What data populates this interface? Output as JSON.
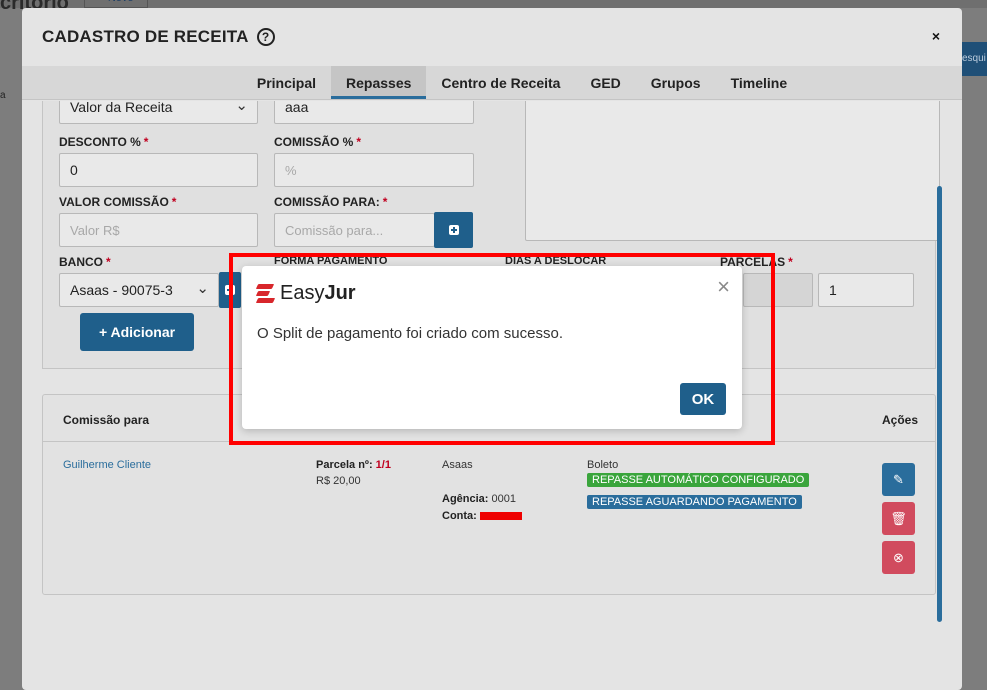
{
  "background": {
    "page_title": "critório",
    "new_button": "+ Novo",
    "left_text": "a",
    "search_btn": "esqui"
  },
  "modal": {
    "title": "CADASTRO DE RECEITA",
    "help_icon": "question-circle-icon",
    "close": "×",
    "tabs": [
      {
        "label": "Principal"
      },
      {
        "label": "Repasses"
      },
      {
        "label": "Centro de Receita"
      },
      {
        "label": "GED"
      },
      {
        "label": "Grupos"
      },
      {
        "label": "Timeline"
      }
    ],
    "active_tab": "Repasses"
  },
  "form": {
    "tipo_valor": "Valor da Receita",
    "descricao_value": "aaa",
    "desconto_label": "DESCONTO %",
    "desconto_value": "0",
    "comissao_pct_label": "COMISSÃO %",
    "comissao_pct_placeholder": "%",
    "valor_comissao_label": "VALOR COMISSÃO",
    "valor_comissao_placeholder": "Valor R$",
    "comissao_para_label": "COMISSÃO PARA:",
    "comissao_para_placeholder": "Comissão para...",
    "banco_label": "BANCO",
    "banco_value": "Asaas - 90075-3",
    "forma_pagamento_label": "FORMA PAGAMENTO",
    "dias_label": "DIAS A DESLOCAR",
    "parcelas_label": "PARCELAS",
    "parcelas_value": "1",
    "required_mark": "*",
    "adicionar_button": "+ Adicionar"
  },
  "table": {
    "headers": {
      "comissao_para": "Comissão para",
      "acoes": "Ações"
    },
    "row": {
      "nome": "Guilherme Cliente",
      "parcela_label": "Parcela nº:",
      "parcela_value": "1/1",
      "valor": "R$ 20,00",
      "banco": "Asaas",
      "agencia_label": "Agência:",
      "agencia_value": "0001",
      "conta_label": "Conta:",
      "forma": "Boleto",
      "tag_configurado": "REPASSE AUTOMÁTICO CONFIGURADO",
      "tag_aguardando": "REPASSE AGUARDANDO PAGAMENTO"
    }
  },
  "alert": {
    "brand_light": "Easy",
    "brand_bold": "Jur",
    "close": "×",
    "message": "O Split de pagamento foi criado com sucesso.",
    "ok_button": "OK"
  },
  "colors": {
    "primary": "#1f5f8b",
    "danger": "#d14b5e",
    "success": "#3aa53c",
    "highlight": "#ff0000",
    "brand_red": "#d8262b"
  }
}
